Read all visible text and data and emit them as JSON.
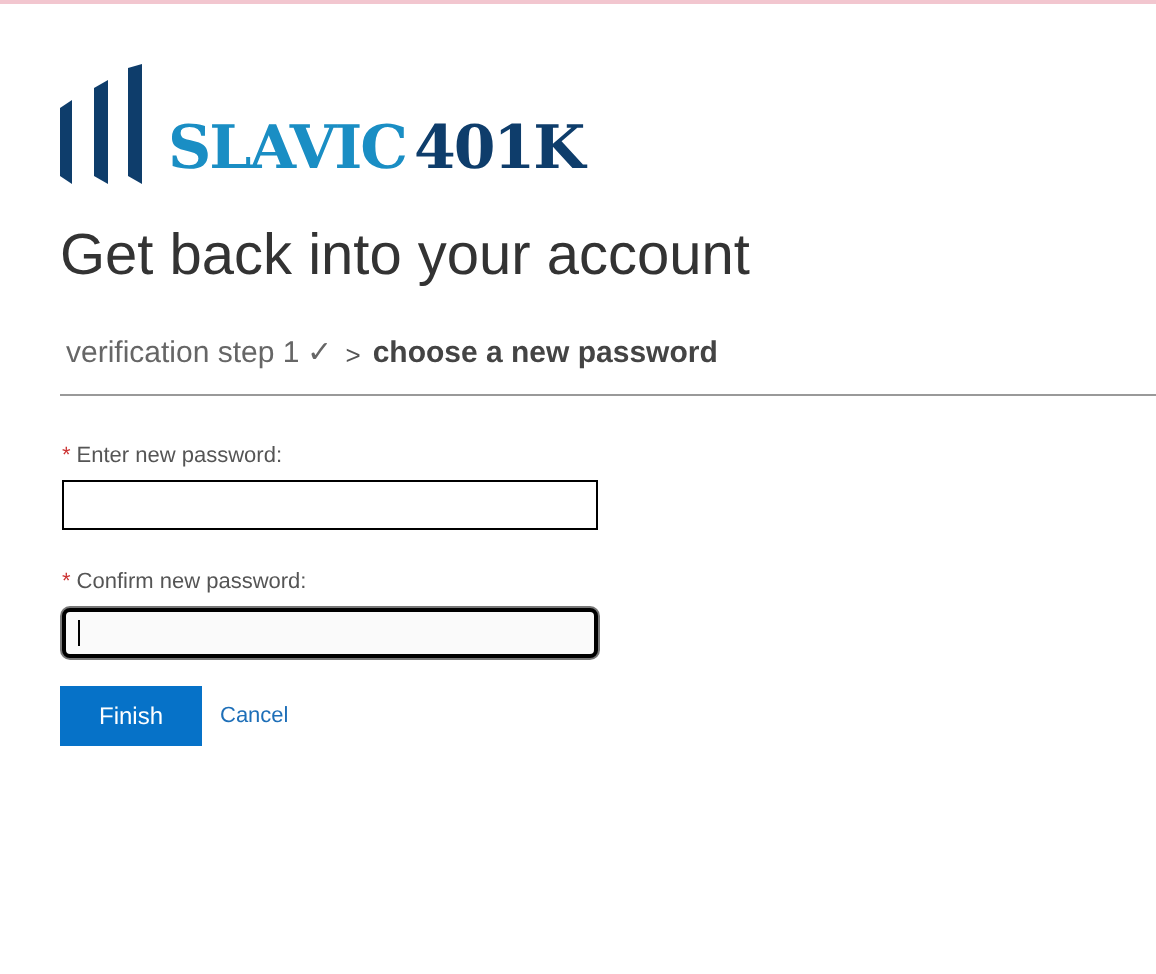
{
  "logo": {
    "brand": "SLAVIC",
    "suffix": "401K"
  },
  "heading": "Get back into your account",
  "breadcrumb": [
    {
      "label": "verification step 1",
      "check": "✓",
      "selected": false
    },
    {
      "label": "choose a new password",
      "selected": true
    }
  ],
  "breadcrumb_separator": ">",
  "fields": [
    {
      "required_mark": "*",
      "label": "Enter new password:",
      "focused": false
    },
    {
      "required_mark": "*",
      "label": "Confirm new password:",
      "focused": true
    }
  ],
  "buttons": [
    {
      "kind": "primary",
      "label": "Finish"
    },
    {
      "kind": "link",
      "label": "Cancel"
    }
  ]
}
